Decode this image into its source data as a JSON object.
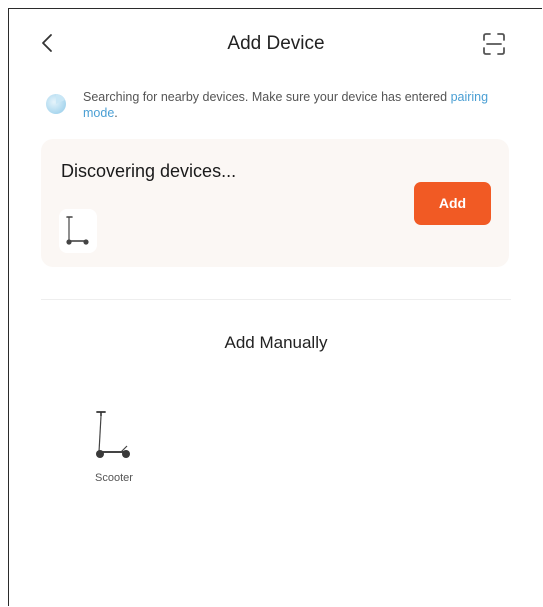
{
  "header": {
    "title": "Add Device",
    "back_icon": "chevron-left-icon",
    "scan_icon": "scan-icon"
  },
  "tip": {
    "text": "Searching for nearby devices. Make sure your device has entered ",
    "link": "pairing mode",
    "suffix": ".",
    "icon": "searching-radar-icon"
  },
  "discovery": {
    "title": "Discovering devices...",
    "device_icon": "scooter-icon",
    "add_label": "Add"
  },
  "manual": {
    "title": "Add Manually",
    "categories": [
      {
        "label": "Scooter",
        "icon": "scooter-icon"
      }
    ]
  },
  "colors": {
    "accent": "#f15a24",
    "link": "#4a9fd4",
    "card_bg": "#fbf7f4"
  }
}
